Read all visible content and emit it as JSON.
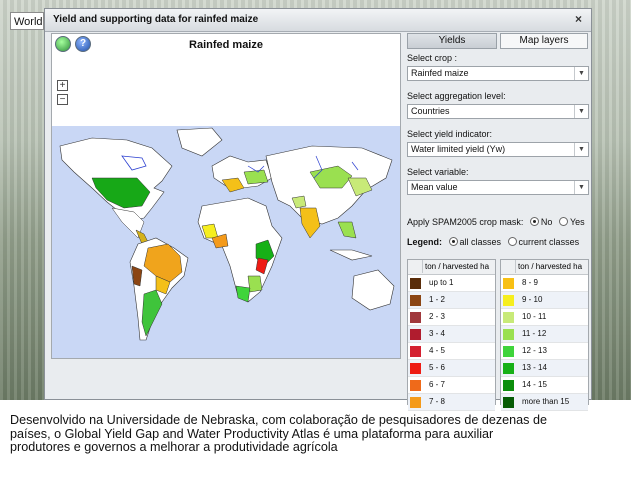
{
  "background": {
    "search_value": "World"
  },
  "dialog": {
    "title": "Yield and supporting data for rainfed maize",
    "close": "×",
    "help_label": "?"
  },
  "map": {
    "title": "Rainfed maize",
    "zoom_in": "+",
    "zoom_out": "−"
  },
  "tabs": {
    "yields": "Yields",
    "map_layers": "Map layers"
  },
  "controls": {
    "crop_label": "Select crop :",
    "crop_value": "Rainfed maize",
    "aggregation_label": "Select aggregation level:",
    "aggregation_value": "Countries",
    "indicator_label": "Select yield indicator:",
    "indicator_value": "Water limited yield (Yw)",
    "variable_label": "Select variable:",
    "variable_value": "Mean value",
    "mask_label": "Apply SPAM2005 crop mask:",
    "mask_no": "No",
    "mask_yes": "Yes",
    "legend_label": "Legend:",
    "legend_all": "all classes",
    "legend_current": "current classes"
  },
  "legend": {
    "header": "ton / harvested ha",
    "left": [
      {
        "label": "up to 1",
        "color": "#5a2d0a"
      },
      {
        "label": "1 - 2",
        "color": "#8b4513"
      },
      {
        "label": "2 - 3",
        "color": "#a0383c"
      },
      {
        "label": "3 - 4",
        "color": "#b01c2e"
      },
      {
        "label": "4 - 5",
        "color": "#d42030"
      },
      {
        "label": "5 - 6",
        "color": "#ee1c14"
      },
      {
        "label": "6 - 7",
        "color": "#ef6a1a"
      },
      {
        "label": "7 - 8",
        "color": "#f49a1a"
      }
    ],
    "right": [
      {
        "label": "8 - 9",
        "color": "#f8c014"
      },
      {
        "label": "9 - 10",
        "color": "#f6ee1e"
      },
      {
        "label": "10 - 11",
        "color": "#c8ea78"
      },
      {
        "label": "11 - 12",
        "color": "#9ae050"
      },
      {
        "label": "12 - 13",
        "color": "#3fd43b"
      },
      {
        "label": "13 - 14",
        "color": "#17b017"
      },
      {
        "label": "14 - 15",
        "color": "#0c8e0c"
      },
      {
        "label": "more than 15",
        "color": "#055b05"
      }
    ]
  },
  "caption": "Desenvolvido na Universidade de Nebraska, com colaboração de pesquisadores de dezenas de países, o Global Yield Gap and Water Productivity Atlas é uma plataforma para auxiliar produtores e governos a melhorar a produtividade agrícola"
}
